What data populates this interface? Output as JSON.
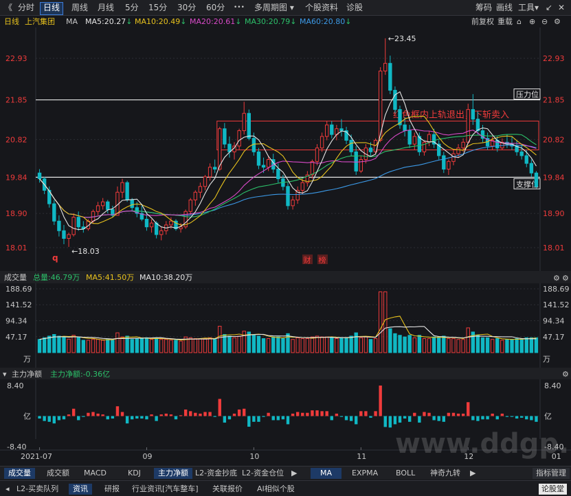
{
  "toolbar": {
    "back_glyph": "《",
    "periods": [
      "分时",
      "日线",
      "周线",
      "月线",
      "5分",
      "15分",
      "30分",
      "60分"
    ],
    "active_period": "日线",
    "more_glyph": "•••",
    "multi_period": "多周期图",
    "stock_info": "个股资料",
    "diagnose": "诊股",
    "chips": "筹码",
    "draw": "画线",
    "tools": "工具",
    "window_glyphs": [
      "↙",
      "✕"
    ]
  },
  "subbar": {
    "period": "日线",
    "stock": "上汽集团",
    "ma_label": "MA",
    "ma5": "MA5:20.27",
    "ma10": "MA10:20.49",
    "ma20": "MA20:20.61",
    "ma30": "MA30:20.79",
    "ma60": "MA60:20.80",
    "adj": "前复权",
    "overlay": "重载",
    "colors": {
      "ma5": "#e6e6e6",
      "ma10": "#e8c21d",
      "ma20": "#d94ac8",
      "ma30": "#2cc16a",
      "ma60": "#3c9ae8"
    }
  },
  "colors": {
    "up": "#ef3b3b",
    "down": "#10b8c4",
    "bg": "#16171b",
    "grid": "#2c2e34"
  },
  "chart_data": [
    {
      "type": "candlestick",
      "title": "上汽集团 日线",
      "y_ticks": [
        "22.93",
        "21.85",
        "20.82",
        "19.84",
        "18.90",
        "18.01"
      ],
      "ylim": [
        18.01,
        23.45
      ],
      "x_ticks": [
        "2021-07",
        "09",
        "10",
        "11",
        "12",
        "01"
      ],
      "max_label": "23.45",
      "min_label": "18.03",
      "resistance": {
        "value": 21.85,
        "label": "压力位"
      },
      "support": {
        "value": 19.84,
        "label": "支撑位"
      },
      "box": {
        "top": 21.3,
        "bottom": 20.55,
        "label": "红色框内上轨退出，下斩卖入"
      },
      "event_tags": [
        "财",
        "榜"
      ],
      "marker_q": "q",
      "ohlc": [
        [
          19.95,
          20.05,
          19.7,
          19.8
        ],
        [
          19.8,
          19.85,
          19.4,
          19.5
        ],
        [
          19.5,
          19.6,
          19.05,
          19.15
        ],
        [
          19.15,
          19.25,
          18.6,
          18.7
        ],
        [
          18.7,
          18.85,
          18.3,
          18.45
        ],
        [
          18.45,
          18.6,
          18.1,
          18.25
        ],
        [
          18.25,
          18.4,
          18.03,
          18.35
        ],
        [
          18.35,
          18.9,
          18.3,
          18.8
        ],
        [
          18.8,
          18.95,
          18.45,
          18.55
        ],
        [
          18.55,
          18.7,
          18.4,
          18.5
        ],
        [
          18.5,
          18.75,
          18.45,
          18.7
        ],
        [
          18.7,
          19.0,
          18.65,
          18.95
        ],
        [
          18.95,
          19.2,
          18.85,
          19.1
        ],
        [
          19.1,
          19.3,
          19.0,
          19.2
        ],
        [
          19.2,
          19.25,
          18.9,
          19.0
        ],
        [
          19.0,
          19.1,
          18.8,
          18.85
        ],
        [
          18.85,
          19.6,
          18.85,
          19.45
        ],
        [
          19.45,
          19.8,
          19.3,
          19.7
        ],
        [
          19.7,
          19.75,
          19.2,
          19.25
        ],
        [
          19.25,
          19.3,
          18.95,
          19.05
        ],
        [
          19.05,
          19.2,
          18.8,
          18.9
        ],
        [
          18.9,
          19.1,
          18.7,
          18.75
        ],
        [
          18.75,
          18.9,
          18.45,
          18.55
        ],
        [
          18.55,
          18.75,
          18.4,
          18.65
        ],
        [
          18.65,
          18.7,
          18.25,
          18.35
        ],
        [
          18.35,
          18.55,
          18.2,
          18.45
        ],
        [
          18.45,
          18.7,
          18.35,
          18.6
        ],
        [
          18.6,
          18.8,
          18.5,
          18.7
        ],
        [
          18.7,
          18.75,
          18.45,
          18.5
        ],
        [
          18.5,
          18.65,
          18.4,
          18.55
        ],
        [
          18.55,
          19.0,
          18.5,
          18.95
        ],
        [
          18.95,
          19.3,
          18.85,
          19.25
        ],
        [
          19.25,
          19.5,
          19.1,
          19.45
        ],
        [
          19.45,
          19.7,
          19.3,
          19.6
        ],
        [
          19.6,
          19.9,
          19.5,
          19.85
        ],
        [
          19.85,
          20.2,
          19.75,
          20.1
        ],
        [
          20.1,
          20.3,
          19.95,
          20.05
        ],
        [
          20.05,
          21.15,
          20.0,
          21.1
        ],
        [
          21.1,
          21.25,
          20.6,
          20.7
        ],
        [
          20.7,
          20.9,
          20.35,
          20.5
        ],
        [
          20.5,
          20.75,
          20.3,
          20.65
        ],
        [
          20.65,
          21.1,
          20.55,
          21.05
        ],
        [
          21.05,
          21.8,
          20.95,
          21.5
        ],
        [
          21.5,
          21.6,
          20.8,
          20.85
        ],
        [
          20.85,
          21.0,
          20.4,
          20.5
        ],
        [
          20.5,
          20.6,
          20.05,
          20.15
        ],
        [
          20.15,
          20.35,
          19.95,
          20.1
        ],
        [
          20.1,
          20.4,
          20.0,
          20.3
        ],
        [
          20.3,
          20.45,
          19.95,
          20.05
        ],
        [
          20.05,
          20.2,
          19.7,
          19.8
        ],
        [
          19.8,
          19.9,
          19.5,
          19.6
        ],
        [
          19.6,
          19.7,
          19.0,
          19.1
        ],
        [
          19.1,
          19.35,
          19.0,
          19.25
        ],
        [
          19.25,
          19.6,
          19.15,
          19.5
        ],
        [
          19.5,
          19.8,
          19.4,
          19.7
        ],
        [
          19.7,
          20.0,
          19.6,
          19.9
        ],
        [
          19.9,
          20.3,
          19.8,
          20.25
        ],
        [
          20.25,
          20.7,
          20.15,
          20.6
        ],
        [
          20.6,
          21.0,
          20.5,
          20.9
        ],
        [
          20.9,
          21.3,
          20.8,
          21.2
        ],
        [
          21.2,
          21.3,
          20.85,
          20.95
        ],
        [
          20.95,
          21.2,
          20.8,
          21.1
        ],
        [
          21.1,
          21.35,
          20.9,
          21.05
        ],
        [
          21.05,
          21.15,
          20.7,
          20.8
        ],
        [
          20.8,
          20.95,
          20.4,
          20.5
        ],
        [
          20.5,
          20.65,
          19.9,
          20.0
        ],
        [
          20.0,
          20.4,
          19.95,
          20.3
        ],
        [
          20.3,
          20.7,
          20.2,
          20.6
        ],
        [
          20.6,
          20.75,
          20.4,
          20.5
        ],
        [
          20.5,
          20.85,
          20.45,
          20.8
        ],
        [
          20.8,
          22.7,
          20.75,
          22.6
        ],
        [
          22.6,
          23.45,
          22.5,
          22.8
        ],
        [
          22.8,
          23.0,
          22.0,
          22.1
        ],
        [
          22.1,
          22.2,
          21.5,
          21.6
        ],
        [
          21.6,
          21.7,
          21.1,
          21.2
        ],
        [
          21.2,
          21.4,
          20.9,
          21.05
        ],
        [
          21.05,
          21.2,
          20.6,
          20.7
        ],
        [
          20.7,
          21.0,
          20.55,
          20.9
        ],
        [
          20.9,
          21.0,
          20.4,
          20.5
        ],
        [
          20.5,
          20.8,
          20.4,
          20.75
        ],
        [
          20.75,
          21.05,
          20.65,
          20.95
        ],
        [
          20.95,
          21.1,
          20.6,
          20.7
        ],
        [
          20.7,
          20.8,
          20.3,
          20.4
        ],
        [
          20.4,
          20.5,
          19.95,
          20.05
        ],
        [
          20.05,
          20.3,
          19.9,
          20.25
        ],
        [
          20.25,
          20.55,
          20.15,
          20.45
        ],
        [
          20.45,
          20.7,
          20.35,
          20.6
        ],
        [
          20.6,
          20.85,
          20.5,
          20.75
        ],
        [
          20.75,
          21.75,
          20.7,
          21.6
        ],
        [
          21.6,
          22.0,
          21.2,
          21.35
        ],
        [
          21.35,
          21.55,
          20.95,
          21.05
        ],
        [
          21.05,
          21.2,
          20.75,
          20.85
        ],
        [
          20.85,
          21.0,
          20.55,
          20.65
        ],
        [
          20.65,
          20.9,
          20.55,
          20.8
        ],
        [
          20.8,
          20.9,
          20.5,
          20.6
        ],
        [
          20.6,
          20.85,
          20.55,
          20.75
        ],
        [
          20.75,
          20.95,
          20.6,
          20.7
        ],
        [
          20.7,
          20.9,
          20.55,
          20.65
        ],
        [
          20.65,
          20.8,
          20.4,
          20.5
        ],
        [
          20.5,
          20.7,
          20.3,
          20.4
        ],
        [
          20.4,
          20.55,
          20.1,
          20.2
        ],
        [
          20.2,
          20.3,
          19.85,
          19.95
        ],
        [
          19.95,
          20.0,
          19.55,
          19.6
        ]
      ]
    },
    {
      "type": "bar",
      "title": "成交量",
      "total_label": "总量:46.79万",
      "ma5_label": "MA5:41.50万",
      "ma10_label": "MA10:38.20万",
      "y_ticks": [
        "188.69",
        "141.52",
        "94.34",
        "47.17"
      ],
      "unit": "万",
      "ylim": [
        0,
        188.69
      ]
    },
    {
      "type": "bar",
      "title": "主力净额",
      "value_label": "主力净额:-0.36亿",
      "y_ticks": [
        "8.40",
        "亿",
        "-8.40"
      ],
      "ylim": [
        -8.4,
        8.4
      ]
    }
  ],
  "bottom_tabs1": [
    "成交量",
    "成交额",
    "MACD",
    "KDJ",
    "主力净额",
    "L2-资金抄底",
    "L2-资金仓位",
    "▶",
    "MA",
    "EXPMA",
    "BOLL",
    "神奇九转"
  ],
  "bottom_tabs1_active": [
    "主力净额",
    "MA"
  ],
  "indicator_manage": "指标管理",
  "bottom_tabs2": [
    "L2-买卖队列",
    "资讯",
    "研报",
    "行业资讯[汽车整车]",
    "关联报价",
    "AI相似个股"
  ],
  "bottom_tabs2_active": "资讯",
  "watermark": "www.ddgp.net",
  "corner_label": "论股堂"
}
